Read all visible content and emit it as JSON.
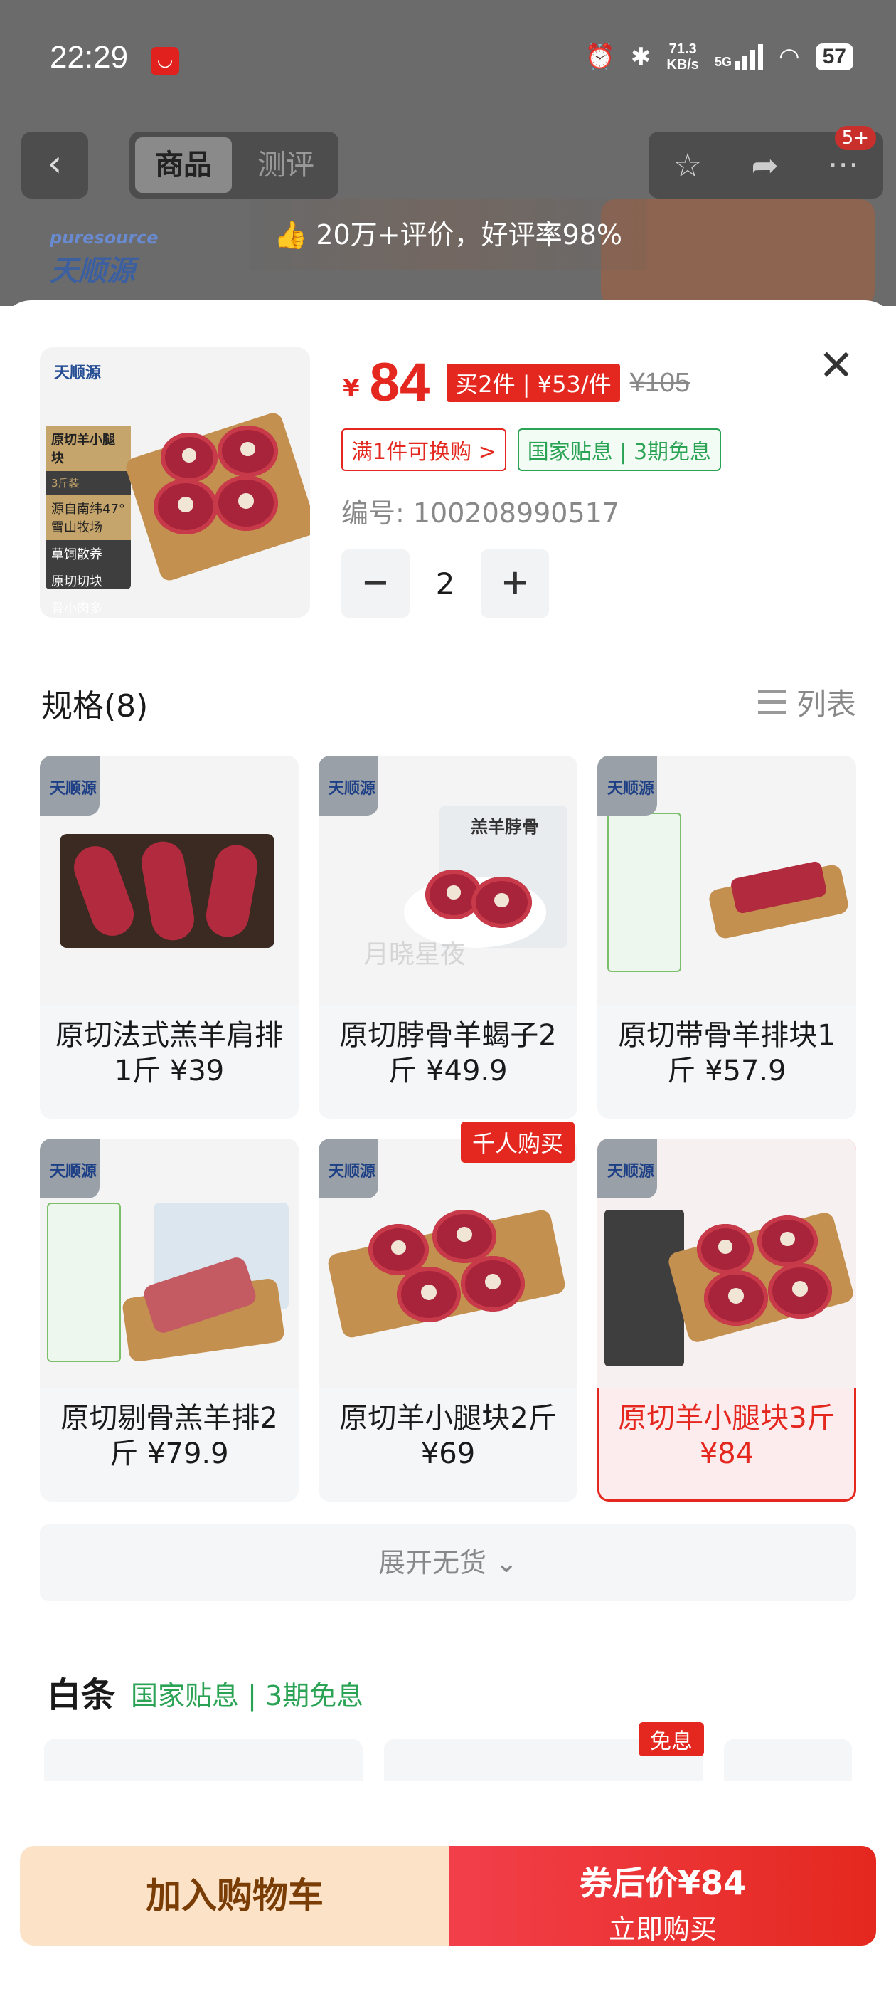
{
  "status_bar": {
    "time": "22:29",
    "net_speed_value": "71.3",
    "net_speed_unit": "KB/s",
    "network": "5G",
    "battery": "57"
  },
  "nav": {
    "tab_product": "商品",
    "tab_review": "测评",
    "message_badge": "5+"
  },
  "background": {
    "rating_banner": "20万+评价，好评率98%",
    "brand_logo_en": "puresource",
    "brand_logo_cn": "天顺源"
  },
  "product": {
    "thumb_label_title": "原切羊小腿块",
    "thumb_label_sub": "3斤装",
    "thumb_label_origin": "源自南纬47°雪山牧场",
    "thumb_feature_1": "草饲散养",
    "thumb_feature_2": "原切切块",
    "thumb_feature_3": "骨小肉多",
    "price_symbol": "¥",
    "price": "84",
    "promo": "买2件 | ¥53/件",
    "original_price": "¥105",
    "tag_exchange": "满1件可换购 >",
    "tag_subsidy": "国家贴息 | 3期免息",
    "sku_number": "编号: 100208990517",
    "quantity": "2"
  },
  "specs": {
    "title": "规格(8)",
    "list_toggle": "列表",
    "items": [
      {
        "label": "原切法式羔羊肩排1斤 ¥39"
      },
      {
        "label": "原切脖骨羊蝎子2斤 ¥49.9",
        "img_text": "羔羊脖骨"
      },
      {
        "label": "原切带骨羊排块1斤 ¥57.9"
      },
      {
        "label": "原切剔骨羔羊排2斤 ¥79.9"
      },
      {
        "label": "原切羊小腿块2斤 ¥69"
      },
      {
        "label": "原切羊小腿块3斤 ¥84"
      }
    ],
    "hot_badge": "千人购买",
    "watermark": "月晓星夜",
    "expand_label": "展开无货 ⌄"
  },
  "baitiao": {
    "title": "白条",
    "promo": "国家贴息 | 3期免息",
    "free_badge": "免息"
  },
  "bottom_bar": {
    "add_to_cart": "加入购物车",
    "buy_price": "券后价¥84",
    "buy_now": "立即购买"
  },
  "colors": {
    "accent_red": "#e4281f",
    "subsidy_green": "#2aa354",
    "cart_bg": "#fce3c8"
  }
}
